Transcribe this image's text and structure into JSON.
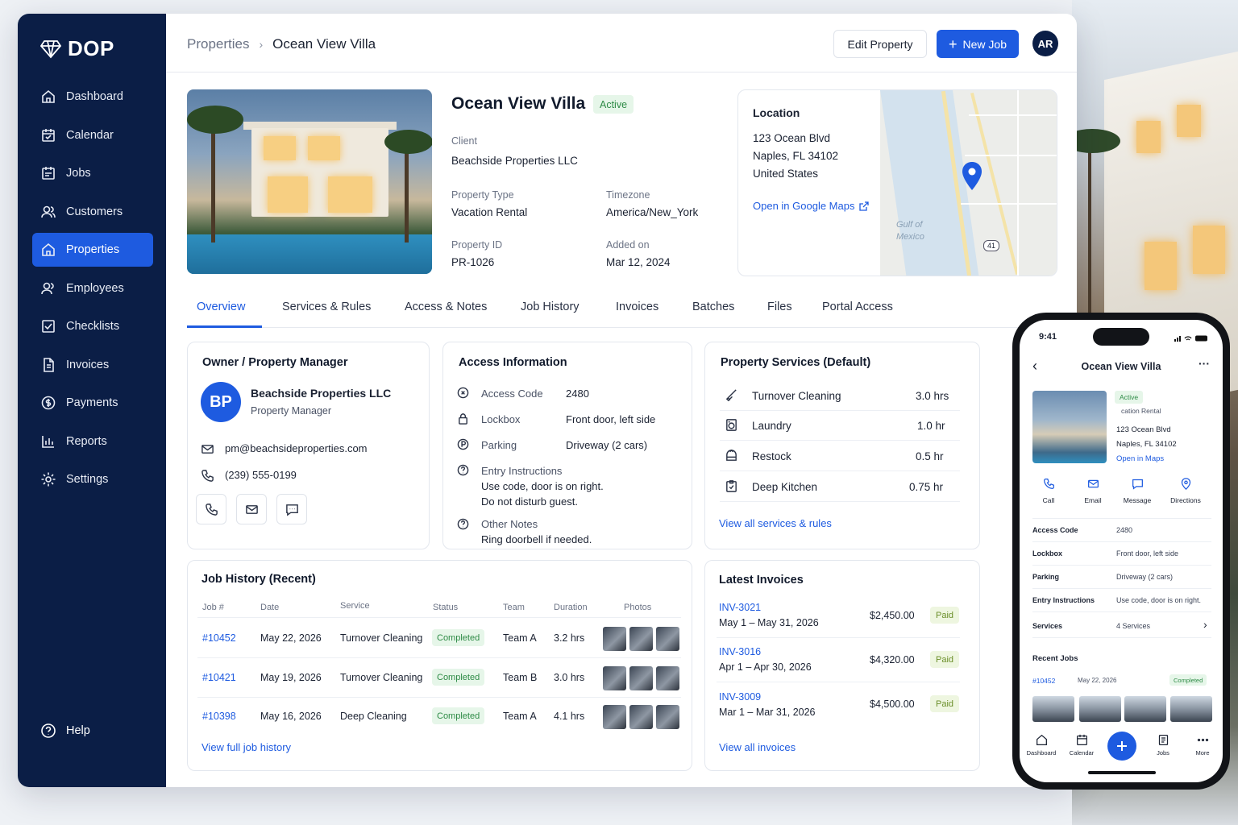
{
  "app": {
    "logo_text": "DOP",
    "logo_icon": "diamond-icon"
  },
  "sidebar": {
    "items": [
      {
        "label": "Dashboard",
        "icon": "home-icon"
      },
      {
        "label": "Calendar",
        "icon": "calendar-icon"
      },
      {
        "label": "Jobs",
        "icon": "jobs-icon"
      },
      {
        "label": "Customers",
        "icon": "users-icon"
      },
      {
        "label": "Properties",
        "icon": "home-icon",
        "active": true
      },
      {
        "label": "Employees",
        "icon": "employees-icon"
      },
      {
        "label": "Checklists",
        "icon": "checklist-icon"
      },
      {
        "label": "Invoices",
        "icon": "invoice-icon"
      },
      {
        "label": "Payments",
        "icon": "payments-icon"
      },
      {
        "label": "Reports",
        "icon": "reports-icon"
      },
      {
        "label": "Settings",
        "icon": "gear-icon"
      }
    ],
    "help_label": "Help"
  },
  "header": {
    "breadcrumb": [
      "Properties",
      "Ocean View Villa"
    ],
    "edit_label": "Edit Property",
    "new_job_label": "New Job",
    "avatar_initials": "AR"
  },
  "property": {
    "name": "Ocean View Villa",
    "status": "Active",
    "client_label": "Client",
    "client": "Beachside Properties LLC",
    "type_label": "Property Type",
    "type": "Vacation Rental",
    "timezone_label": "Timezone",
    "timezone": "America/New_York",
    "id_label": "Property ID",
    "id": "PR-1026",
    "added_label": "Added on",
    "added": "Mar 12, 2024"
  },
  "location": {
    "title": "Location",
    "line1": "123 Ocean Blvd",
    "line2": "Naples, FL 34102",
    "line3": "United States",
    "maps_link": "Open in Google Maps",
    "map_label_1": "Gulf of",
    "map_label_2": "Mexico",
    "route": "41"
  },
  "tabs": [
    "Overview",
    "Services & Rules",
    "Access & Notes",
    "Job History",
    "Invoices",
    "Batches",
    "Files",
    "Portal Access"
  ],
  "owner": {
    "title": "Owner / Property Manager",
    "initials": "BP",
    "name": "Beachside Properties LLC",
    "role": "Property Manager",
    "email": "pm@beachsideproperties.com",
    "phone": "(239) 555-0199"
  },
  "access": {
    "title": "Access Information",
    "code_label": "Access Code",
    "code": "2480",
    "lockbox_label": "Lockbox",
    "lockbox": "Front door, left side",
    "parking_label": "Parking",
    "parking": "Driveway (2 cars)",
    "entry_label": "Entry Instructions",
    "entry_1": "Use code, door is on right.",
    "entry_2": "Do not disturb guest.",
    "notes_label": "Other Notes",
    "notes": "Ring doorbell if needed."
  },
  "services": {
    "title": "Property Services (Default)",
    "items": [
      {
        "name": "Turnover Cleaning",
        "duration": "3.0 hrs"
      },
      {
        "name": "Laundry",
        "duration": "1.0 hr"
      },
      {
        "name": "Restock",
        "duration": "0.5 hr"
      },
      {
        "name": "Deep Kitchen",
        "duration": "0.75 hr"
      }
    ],
    "view_all": "View all services & rules"
  },
  "jobs": {
    "title": "Job History (Recent)",
    "headers": [
      "Job #",
      "Date",
      "Service",
      "Status",
      "Team",
      "Duration",
      "Photos"
    ],
    "rows": [
      {
        "job": "#10452",
        "date": "May 22, 2026",
        "service": "Turnover Cleaning",
        "status": "Completed",
        "team": "Team A",
        "duration": "3.2 hrs"
      },
      {
        "job": "#10421",
        "date": "May 19, 2026",
        "service": "Turnover Cleaning",
        "status": "Completed",
        "team": "Team B",
        "duration": "3.0 hrs"
      },
      {
        "job": "#10398",
        "date": "May 16, 2026",
        "service": "Deep Cleaning",
        "status": "Completed",
        "team": "Team A",
        "duration": "4.1 hrs"
      }
    ],
    "view_all": "View full job history"
  },
  "invoices": {
    "title": "Latest Invoices",
    "rows": [
      {
        "id": "INV-3021",
        "period": "May 1 – May 31, 2026",
        "amount": "$2,450.00",
        "status": "Paid"
      },
      {
        "id": "INV-3016",
        "period": "Apr 1 – Apr 30, 2026",
        "amount": "$4,320.00",
        "status": "Paid"
      },
      {
        "id": "INV-3009",
        "period": "Mar 1 – Mar 31, 2026",
        "amount": "$4,500.00",
        "status": "Paid"
      }
    ],
    "view_all": "View all invoices"
  },
  "phone": {
    "time": "9:41",
    "title": "Ocean View Villa",
    "status": "Active",
    "type_partial": "cation Rental",
    "addr1": "123 Ocean Blvd",
    "addr2": "Naples, FL 34102",
    "maps": "Open in Maps",
    "actions": [
      "Call",
      "Email",
      "Message",
      "Directions"
    ],
    "rows": [
      {
        "label": "Access Code",
        "value": "2480"
      },
      {
        "label": "Lockbox",
        "value": "Front door, left side"
      },
      {
        "label": "Parking",
        "value": "Driveway (2 cars)"
      },
      {
        "label": "Entry Instructions",
        "value": "Use code, door is on right."
      },
      {
        "label": "Services",
        "value": "4 Services"
      }
    ],
    "recent_title": "Recent Jobs",
    "recent_job": "#10452",
    "recent_date": "May 22, 2026",
    "recent_status": "Completed",
    "nav": [
      "Dashboard",
      "Calendar",
      "Jobs",
      "More"
    ]
  },
  "colors": {
    "accent": "#1e5be0",
    "sidebar": "#0b1e46",
    "success": "#2e8b46"
  }
}
